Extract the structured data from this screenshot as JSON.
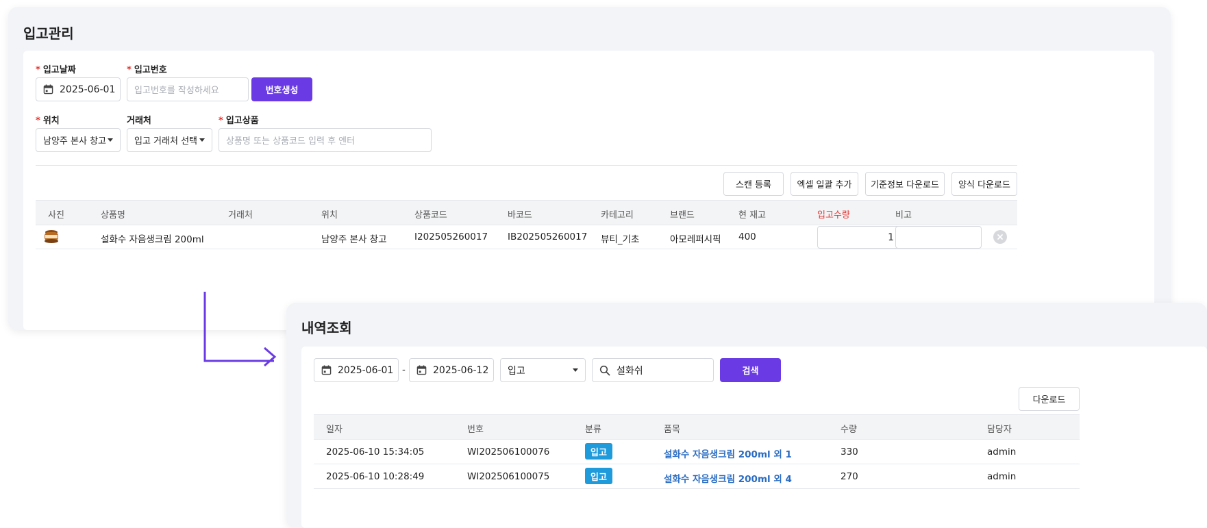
{
  "receiving": {
    "title": "입고관리",
    "form": {
      "date_label": "입고날짜",
      "date_value": "2025-06-01",
      "number_label": "입고번호",
      "number_placeholder": "입고번호를 작성하세요",
      "generate_button": "번호생성",
      "location_label": "위치",
      "location_value": "남양주 본사 창고",
      "vendor_label": "거래처",
      "vendor_value": "입고 거래처 선택",
      "product_label": "입고상품",
      "product_placeholder": "상품명 또는 상품코드 입력 후 엔터"
    },
    "actions": [
      "스캔 등록",
      "엑셀 일괄 추가",
      "기준정보 다운로드",
      "양식 다운로드"
    ],
    "table": {
      "headers": [
        "사진",
        "상품명",
        "거래처",
        "위치",
        "상품코드",
        "바코드",
        "카테고리",
        "브랜드",
        "현 재고",
        "입고수량",
        "비고"
      ],
      "rows": [
        {
          "name": "설화수 자음생크림 200ml",
          "vendor": "",
          "location": "남양주 본사 창고",
          "code": "I202505260017",
          "barcode": "IB202505260017",
          "category": "뷰티_기초",
          "brand": "아모레퍼시픽",
          "stock": "400",
          "qty": "1",
          "note": ""
        }
      ]
    }
  },
  "history": {
    "title": "내역조회",
    "filters": {
      "start_date": "2025-06-01",
      "separator": "-",
      "end_date": "2025-06-12",
      "type_value": "입고",
      "search_value": "설화쉬",
      "search_button": "검색"
    },
    "download_button": "다운로드",
    "table": {
      "headers": [
        "일자",
        "번호",
        "분류",
        "품목",
        "수량",
        "담당자"
      ],
      "rows": [
        {
          "date": "2025-06-10 15:34:05",
          "number": "WI202506100076",
          "type": "입고",
          "item": "설화수 자음생크림 200ml 외 1",
          "qty": "330",
          "manager": "admin"
        },
        {
          "date": "2025-06-10 10:28:49",
          "number": "WI202506100075",
          "type": "입고",
          "item": "설화수 자음생크림 200ml 외 4",
          "qty": "270",
          "manager": "admin"
        }
      ]
    }
  },
  "colors": {
    "primary": "#6a3be4",
    "badge": "#1f9bdc",
    "link": "#2a6cc2",
    "required": "#e5322e"
  }
}
